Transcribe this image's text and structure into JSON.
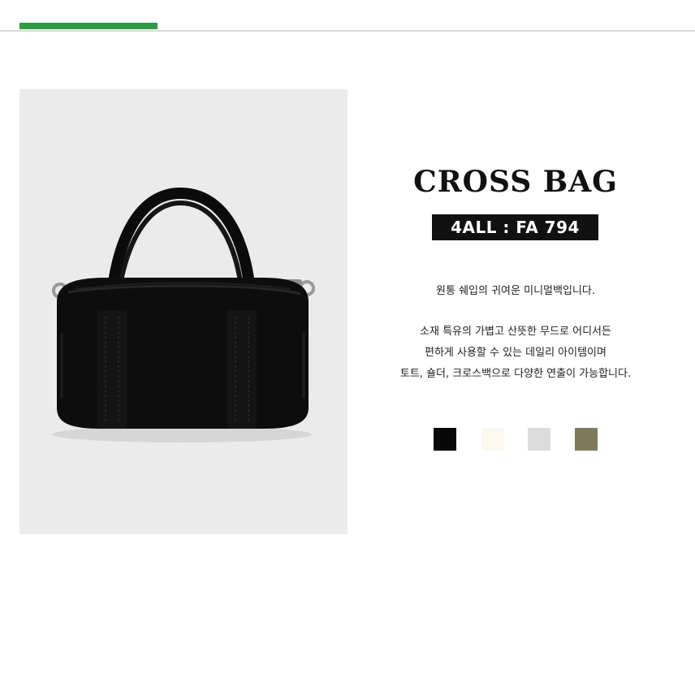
{
  "header": {
    "accent_color": "#2e9a43"
  },
  "product": {
    "image_icon": "black-mini-duffle-bag-photo",
    "title": "CROSS BAG",
    "model": "4ALL : FA 794",
    "description_line1": "원통 쉐입의 귀여운 미니멀백입니다.",
    "description_lines": [
      "소재 특유의 가볍고 산뜻한 무드로 어디서든",
      "편하게 사용할 수 있는 데일리 아이템이며",
      "토트, 숄더, 크로스백으로 다양한 연출이 가능합니다."
    ],
    "color_swatches": [
      {
        "color": "#080808"
      },
      {
        "color": "#fbf8ef"
      },
      {
        "color": "#dcdcdc"
      },
      {
        "color": "#7e7b5c"
      }
    ]
  }
}
